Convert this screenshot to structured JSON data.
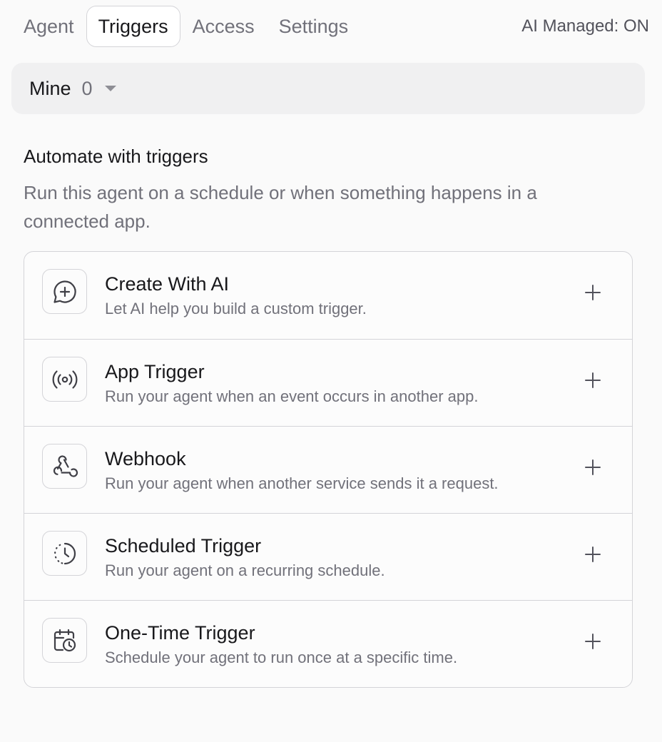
{
  "tabs": [
    {
      "label": "Agent"
    },
    {
      "label": "Triggers"
    },
    {
      "label": "Access"
    },
    {
      "label": "Settings"
    }
  ],
  "active_tab": "Triggers",
  "ai_managed": "AI Managed: ON",
  "filter": {
    "label": "Mine",
    "count": "0"
  },
  "section": {
    "title": "Automate with triggers",
    "description": "Run this agent on a schedule or when something happens in a connected app."
  },
  "triggers": [
    {
      "title": "Create With AI",
      "description": "Let AI help you build a custom trigger.",
      "icon": "chat-plus-icon"
    },
    {
      "title": "App Trigger",
      "description": "Run your agent when an event occurs in another app.",
      "icon": "broadcast-icon"
    },
    {
      "title": "Webhook",
      "description": "Run your agent when another service sends it a request.",
      "icon": "webhook-icon"
    },
    {
      "title": "Scheduled Trigger",
      "description": "Run your agent on a recurring schedule.",
      "icon": "clock-dashed-icon"
    },
    {
      "title": "One-Time Trigger",
      "description": "Schedule your agent to run once at a specific time.",
      "icon": "calendar-clock-icon"
    }
  ],
  "colors": {
    "text": "#18181b",
    "muted": "#71717a",
    "border": "#d4d4d8",
    "background": "#fafafa"
  }
}
